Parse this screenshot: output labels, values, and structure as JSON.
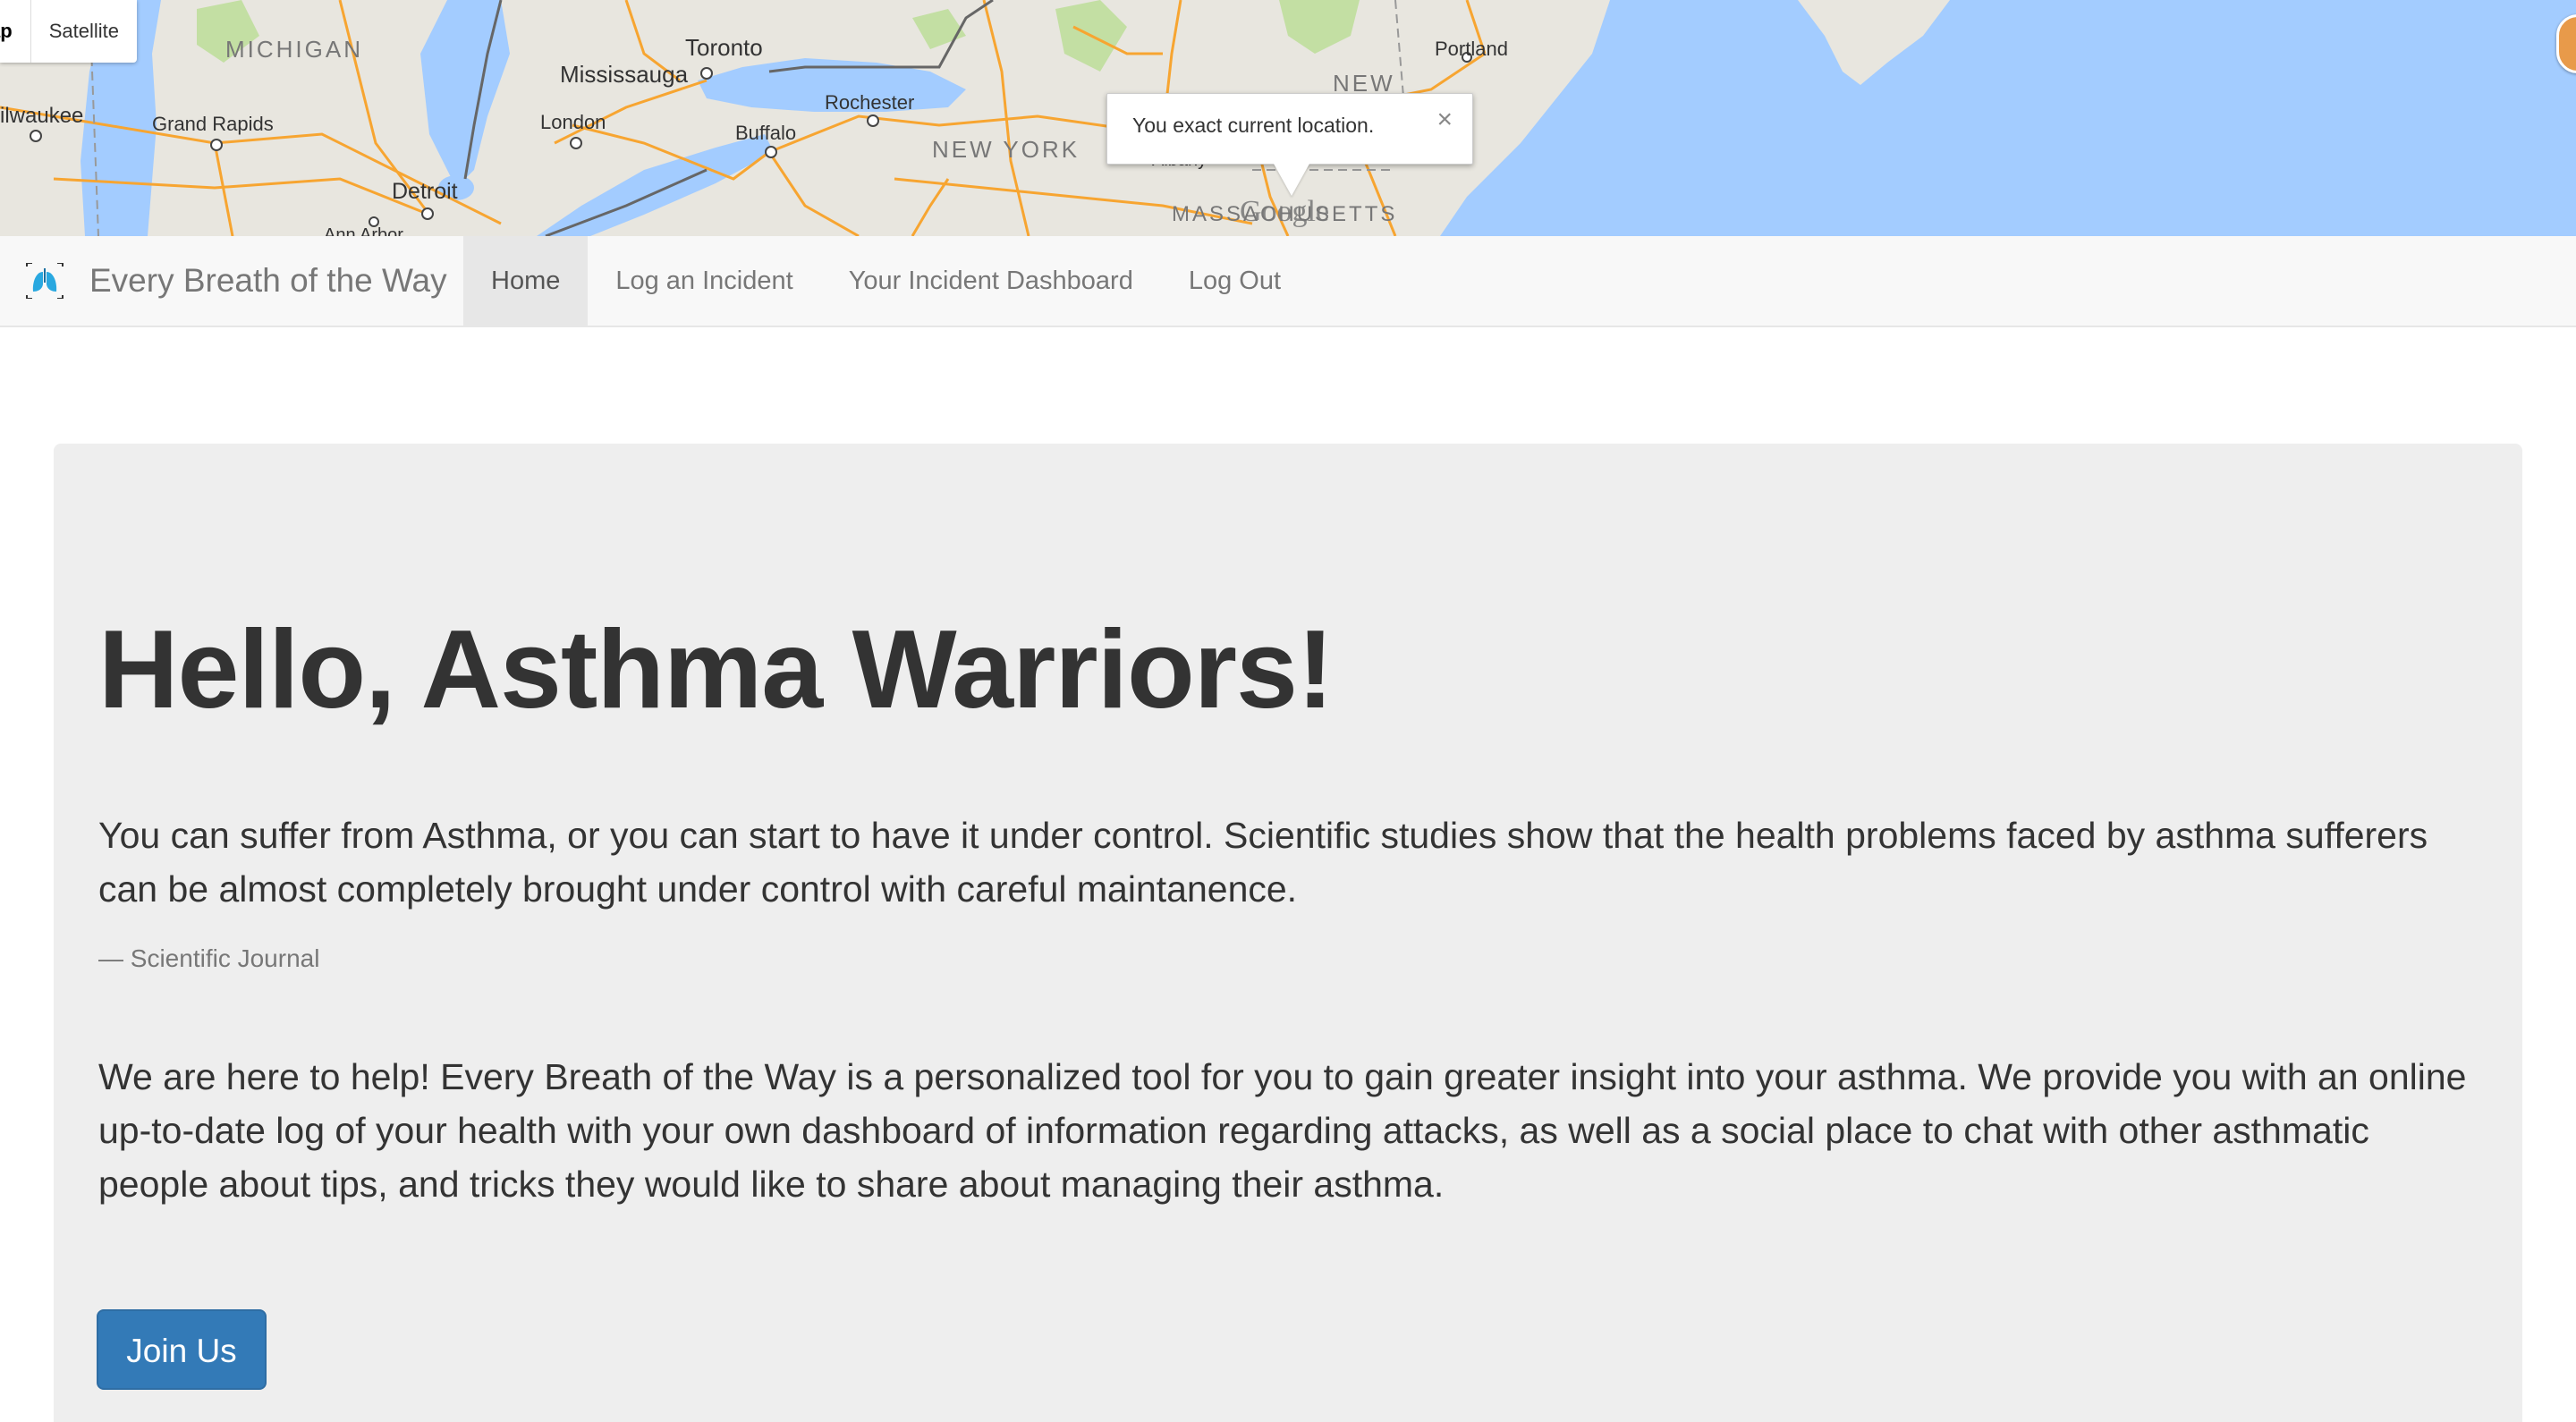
{
  "map": {
    "map_type_options": [
      "ap",
      "Satellite"
    ],
    "labels": {
      "michigan": "MICHIGAN",
      "toronto": "Toronto",
      "mississauga": "Mississauga",
      "milwaukee": "ilwaukee",
      "grand_rapids": "Grand Rapids",
      "london": "London",
      "buffalo": "Buffalo",
      "rochester": "Rochester",
      "new_york": "NEW YORK",
      "detroit": "Detroit",
      "ann_arbor": "Ann Arbor",
      "portland": "Portland",
      "new": "NEW",
      "albany": "Albany",
      "massachusetts": "MASSACHUSETTS"
    },
    "info_window_text": "You exact current location.",
    "info_window_close": "×",
    "attribution": "Google",
    "colors": {
      "water": "#a3ccff",
      "land": "#e8e6df",
      "roads": "#f7a531",
      "parks": "#c3dfa3"
    }
  },
  "navbar": {
    "brand": "Every Breath of the Way",
    "items": [
      {
        "label": "Home",
        "active": true
      },
      {
        "label": "Log an Incident",
        "active": false
      },
      {
        "label": "Your Incident Dashboard",
        "active": false
      },
      {
        "label": "Log Out",
        "active": false
      }
    ]
  },
  "jumbotron": {
    "title": "Hello, Asthma Warriors!",
    "quote": "You can suffer from Asthma, or you can start to have it under control. Scientific studies show that the health problems faced by asthma sufferers can be almost completely brought under control with careful maintanence.",
    "quote_source": "— Scientific Journal",
    "intro": "We are here to help! Every Breath of the Way is a personalized tool for you to gain greater insight into your asthma. We provide you with an online up-to-date log of your health with your own dashboard of information regarding attacks, as well as a social place to chat with other asthmatic people about tips, and tricks they would like to share about managing their asthma.",
    "button_label": "Join Us",
    "button_color": "#337ab7"
  }
}
